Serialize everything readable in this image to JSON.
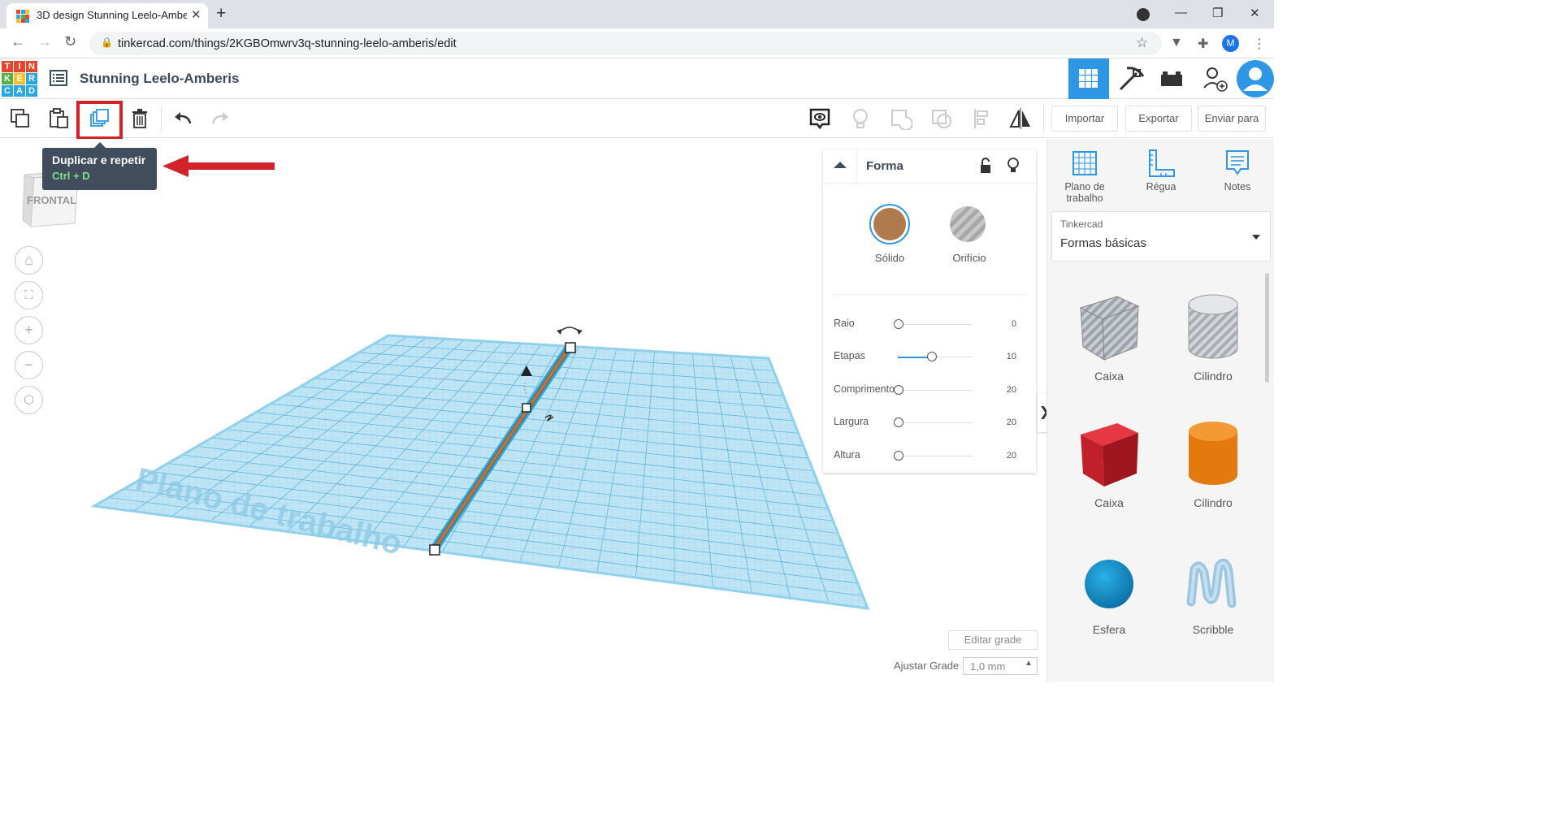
{
  "browser": {
    "tab_title": "3D design Stunning Leelo-Amberis",
    "url": "tinkercad.com/things/2KGBOmwrv3q-stunning-leelo-amberis/edit",
    "profile_initial": "M"
  },
  "app": {
    "logo_letters": [
      "T",
      "I",
      "N",
      "K",
      "E",
      "R",
      "C",
      "A",
      "D"
    ],
    "design_name": "Stunning Leelo-Amberis"
  },
  "toolbar": {
    "import_label": "Importar",
    "export_label": "Exportar",
    "send_label": "Enviar para"
  },
  "tooltip": {
    "title": "Duplicar e repetir",
    "shortcut": "Ctrl + D"
  },
  "viewport": {
    "view_cube_label": "FRONTAL",
    "workplane_label": "Plano de trabalho",
    "edit_grid_label": "Editar grade",
    "snap_grid_label": "Ajustar Grade",
    "snap_grid_value": "1,0 mm"
  },
  "inspector": {
    "title": "Forma",
    "solid_label": "Sólido",
    "hole_label": "Orifício",
    "solid_color": "#b07a4f",
    "params": [
      {
        "label": "Raio",
        "value": "0",
        "fraction": 0.0
      },
      {
        "label": "Etapas",
        "value": "10",
        "fraction": 0.45
      },
      {
        "label": "Comprimento",
        "value": "20",
        "fraction": 0.0
      },
      {
        "label": "Largura",
        "value": "20",
        "fraction": 0.0
      },
      {
        "label": "Altura",
        "value": "20",
        "fraction": 0.0
      }
    ]
  },
  "right_panel": {
    "tools": [
      {
        "label": "Plano de trabalho",
        "icon": "workplane-icon"
      },
      {
        "label": "Régua",
        "icon": "ruler-icon"
      },
      {
        "label": "Notes",
        "icon": "notes-icon"
      }
    ],
    "library_provider": "Tinkercad",
    "library_name": "Formas básicas",
    "shapes": [
      {
        "label": "Caixa",
        "icon": "box-hole-icon"
      },
      {
        "label": "Cilindro",
        "icon": "cylinder-hole-icon"
      },
      {
        "label": "Caixa",
        "icon": "box-red-icon"
      },
      {
        "label": "Cilindro",
        "icon": "cylinder-orange-icon"
      },
      {
        "label": "Esfera",
        "icon": "sphere-icon"
      },
      {
        "label": "Scribble",
        "icon": "scribble-icon"
      }
    ]
  },
  "colors": {
    "accent_blue": "#2d97e5",
    "highlight_red": "#d1242a",
    "grid_blue": "#8fd1ec"
  }
}
